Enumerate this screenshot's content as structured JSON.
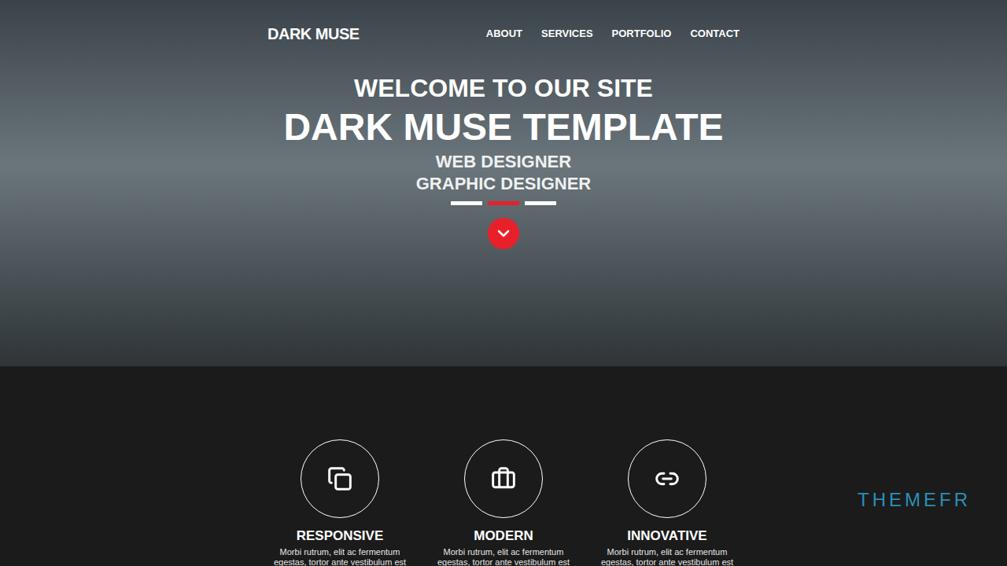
{
  "nav": {
    "logo": "DARK MUSE",
    "links": [
      "ABOUT",
      "SERVICES",
      "PORTFOLIO",
      "CONTACT"
    ]
  },
  "hero": {
    "greeting": "WELCOME TO OUR SITE",
    "title": "DARK MUSE TEMPLATE",
    "roles": [
      "WEB DESIGNER",
      "GRAPHIC DESIGNER"
    ],
    "slides": [
      {
        "selected": false
      },
      {
        "selected": true
      },
      {
        "selected": false
      }
    ]
  },
  "features": [
    {
      "title": "RESPONSIVE",
      "icon": "responsive",
      "text": "Morbi rutrum, elit ac fermentum egestas, tortor ante vestibulum est"
    },
    {
      "title": "MODERN",
      "icon": "modern",
      "text": "Morbi rutrum, elit ac fermentum egestas, tortor ante vestibulum est"
    },
    {
      "title": "INNOVATIVE",
      "icon": "innovative",
      "text": "Morbi rutrum, elit ac fermentum egestas, tortor ante vestibulum est"
    }
  ],
  "watermark": "THEMEFR"
}
